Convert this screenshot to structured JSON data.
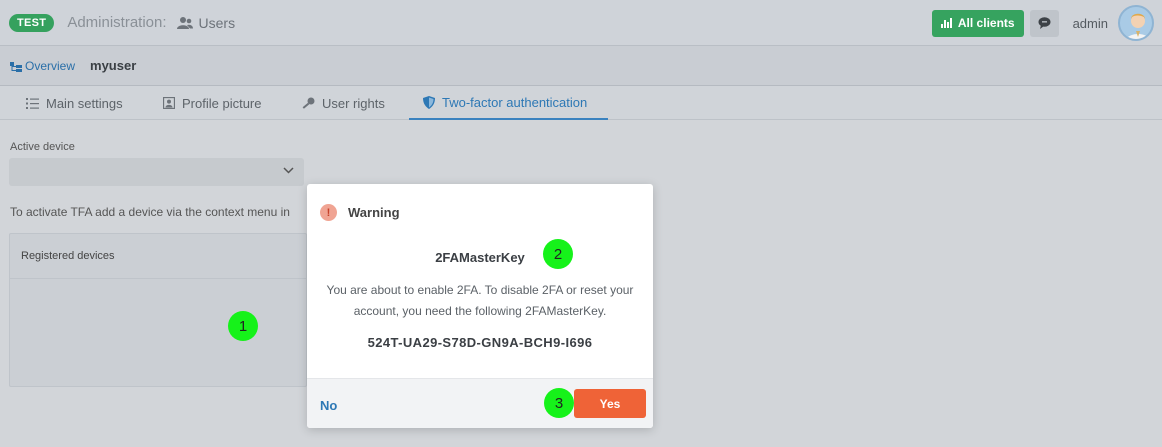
{
  "header": {
    "env_badge": "TEST",
    "section": "Administration:",
    "page": "Users",
    "all_clients": "All clients",
    "user_name": "admin"
  },
  "breadcrumb": {
    "overview": "Overview",
    "current": "myuser"
  },
  "tabs": [
    {
      "label": "Main settings",
      "icon": "list-icon"
    },
    {
      "label": "Profile picture",
      "icon": "portrait-icon"
    },
    {
      "label": "User rights",
      "icon": "key-icon"
    },
    {
      "label": "Two-factor authentication",
      "icon": "shield-icon",
      "active": true
    }
  ],
  "content": {
    "active_device_label": "Active device",
    "active_device_value": "",
    "hint": "To activate TFA add a device via the context menu in",
    "registered_devices": "Registered devices"
  },
  "dialog": {
    "title": "Warning",
    "key_title": "2FAMasterKey",
    "message": "You are about to enable 2FA. To disable 2FA or reset your account, you need the following 2FAMasterKey.",
    "code": "524T-UA29-S78D-GN9A-BCH9-I696",
    "no_label": "No",
    "yes_label": "Yes"
  },
  "markers": [
    "1",
    "2",
    "3"
  ],
  "colors": {
    "accent_green": "#36a35f",
    "primary_blue": "#2d78b5",
    "danger_orange": "#ef6337",
    "marker_green": "#16f21a"
  }
}
